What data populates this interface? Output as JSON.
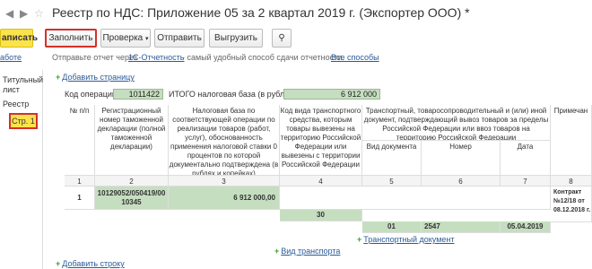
{
  "title": {
    "text": "Реестр по НДС: Приложение 05 за 2 квартал 2019 г. (Экспортер ООО) *",
    "back_icon": "arrow-left-icon",
    "forward_icon": "arrow-right-icon",
    "star_icon": "star-icon"
  },
  "toolbar": {
    "write_label": "аписать",
    "fill_label": "Заполнить",
    "check_label": "Проверка",
    "send_label": "Отправить",
    "upload_label": "Выгрузить",
    "clip_icon": "paperclip-icon"
  },
  "info": {
    "prefix": "аботе",
    "text": "Отправьте отчет через",
    "link1": "1С-Отчетность",
    "middle": "- самый удобный способ сдачи отчетности.",
    "link2": "Все способы"
  },
  "sidebar": {
    "items": [
      "Титульный",
      "лист",
      "Реестр"
    ],
    "page_label": "Стр. 1"
  },
  "content": {
    "add_page": "Добавить страницу",
    "op_code_label": "Код операции:",
    "op_code_value": "1011422",
    "total_label": "ИТОГО налоговая база (в рублях):",
    "total_value": "6 912 000",
    "add_row": "Добавить строку",
    "add_transport": "Вид транспорта",
    "add_doc": "Транспортный документ"
  },
  "table": {
    "headers": {
      "col1": "№ п/п",
      "col2": "Регистрационный номер таможенной декларации (полной таможенной декларации)",
      "col3": "Налоговая база по соответствующей операции по реализации товаров (работ, услуг), обоснованность применения налоговой ставки 0 процентов по которой документально подтверждена (в рублях и копейках)",
      "col4": "Код вида транспортного средства, которым товары вывезены на территорию Российской Федерации или вывезены с территории Российской Федерации",
      "col5_group": "Транспортный, товаросопроводительный и (или) иной документ, подтверждающий вывоз товаров за пределы Российской Федерации или ввоз товаров на территорию Российской Федерации",
      "col5": "Вид документа",
      "col6": "Номер",
      "col7": "Дата",
      "col8": "Примечан"
    },
    "numbers": [
      "1",
      "2",
      "3",
      "4",
      "5",
      "6",
      "7",
      "8"
    ],
    "row": {
      "num": "1",
      "declaration": "10129052/050419/00 10345",
      "tax_base": "6 912 000,00",
      "note": "Контракт №12/18 от 08.12.2018 г."
    },
    "transport_code": "30",
    "doc_type": "01",
    "doc_number": "2547",
    "doc_date": "05.04.2019"
  },
  "colors": {
    "accent_yellow": "#fbe34b",
    "highlight_red": "#d4312a",
    "cell_green": "#c6dec0",
    "link_blue": "#2b5b9a"
  }
}
